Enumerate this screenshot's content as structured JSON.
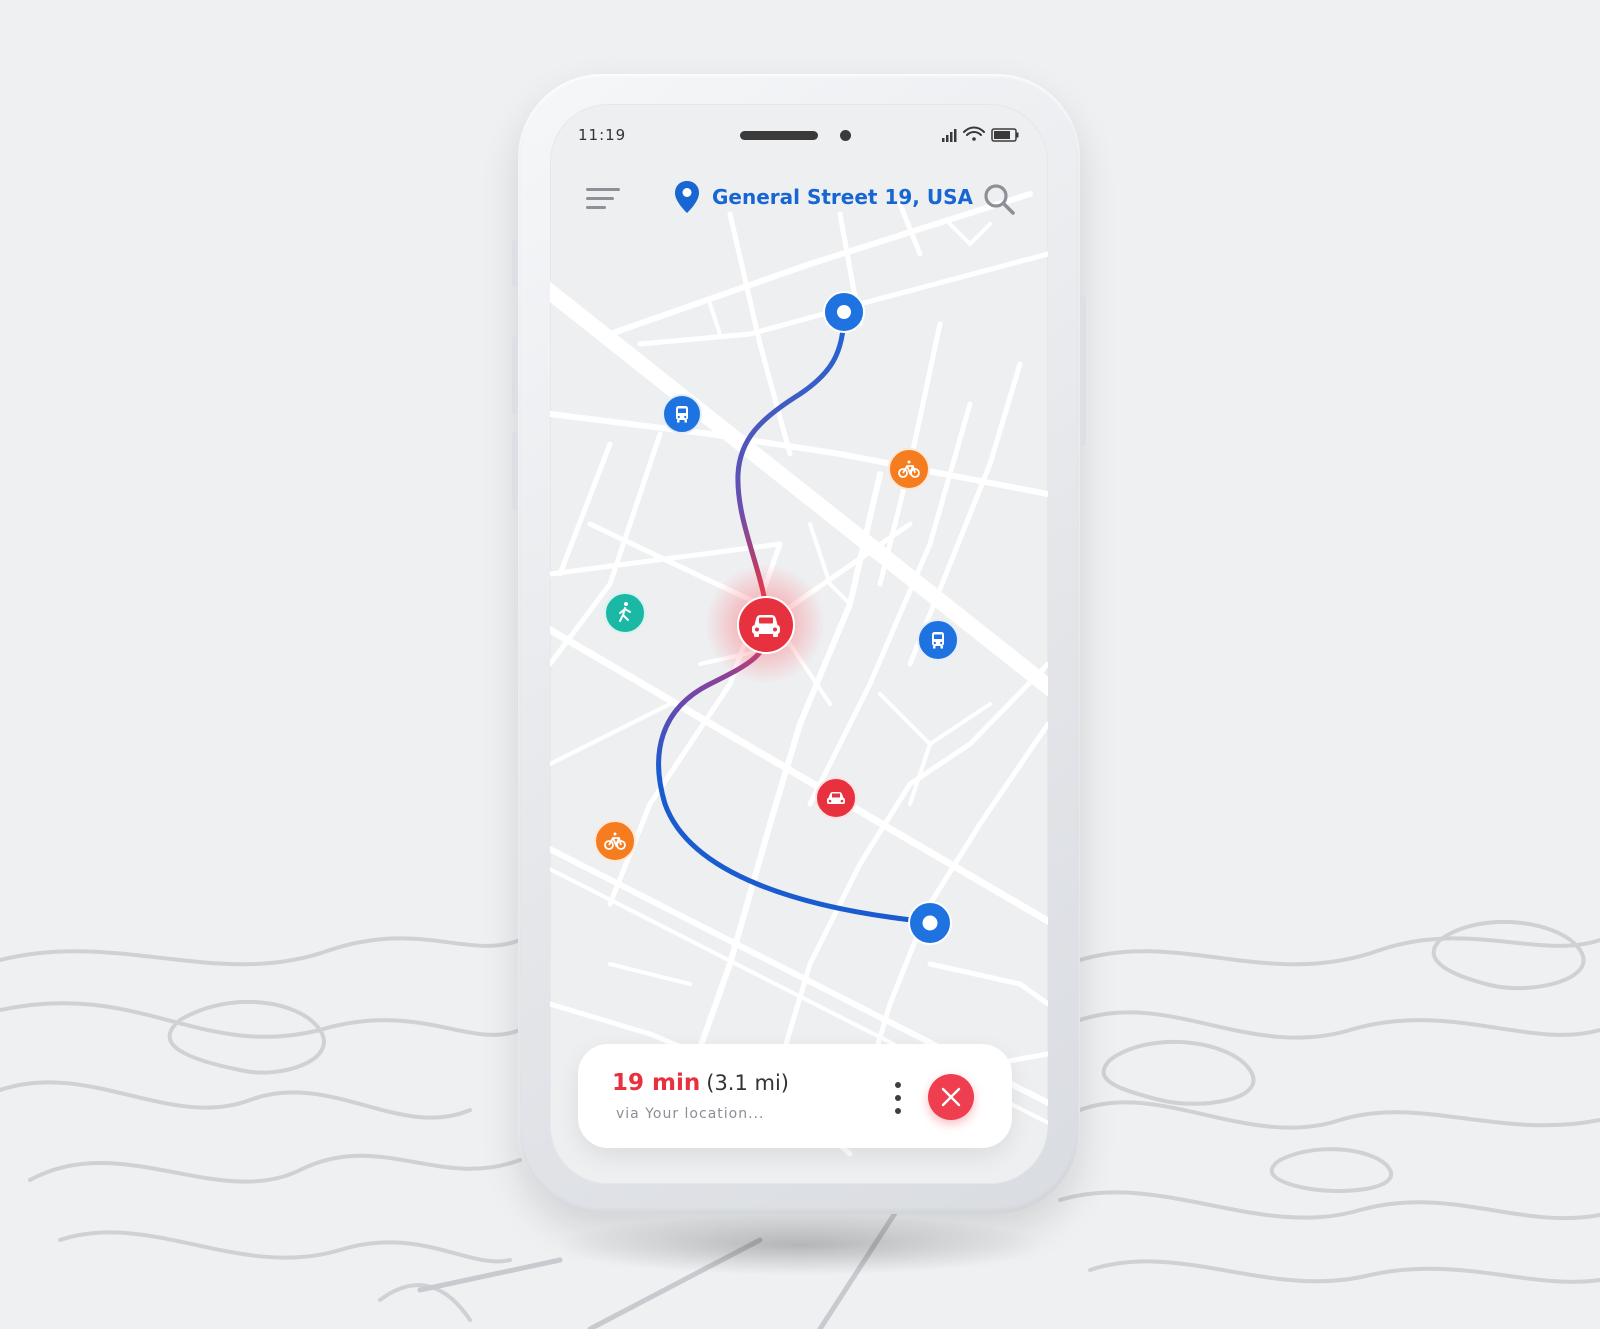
{
  "status_bar": {
    "time": "11:19",
    "icons": [
      "signal-icon",
      "wifi-icon",
      "battery-icon"
    ]
  },
  "header": {
    "location": "General Street 19, USA",
    "icons": [
      "menu-icon",
      "location-pin-icon",
      "search-icon"
    ]
  },
  "map": {
    "route": {
      "start": "route-start-pin",
      "current": "car-marker",
      "end": "route-end-pin",
      "gradient": [
        "#1a66d6",
        "#e8313f",
        "#1a5bd0"
      ]
    },
    "pois": [
      {
        "type": "bus",
        "icon": "bus-icon",
        "color": "#1f73e0"
      },
      {
        "type": "bike",
        "icon": "bicycle-icon",
        "color": "#f57d1f"
      },
      {
        "type": "walk",
        "icon": "walking-icon",
        "color": "#1bb8a6"
      },
      {
        "type": "bus",
        "icon": "bus-icon",
        "color": "#1f73e0"
      },
      {
        "type": "car",
        "icon": "car-icon",
        "color": "#e8313f"
      },
      {
        "type": "bike",
        "icon": "bicycle-icon",
        "color": "#f57d1f"
      }
    ]
  },
  "trip_card": {
    "duration": "19 min",
    "distance": "(3.1 mi)",
    "via": "via Your location..."
  },
  "colors": {
    "accent_blue": "#1766d1",
    "accent_red": "#e8313f",
    "background": "#eff0f2"
  }
}
